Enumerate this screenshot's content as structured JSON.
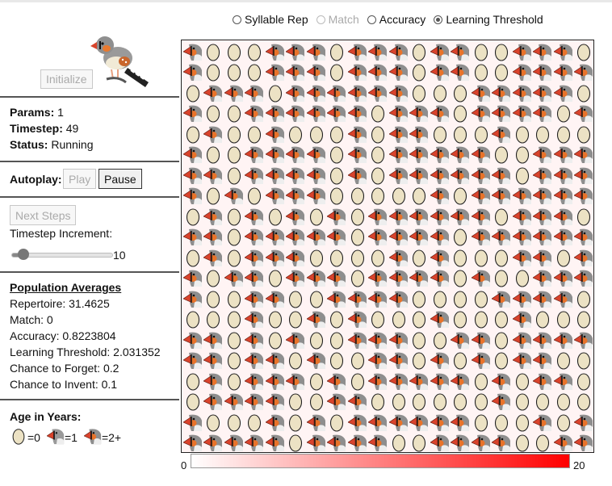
{
  "mode_options": [
    {
      "label": "Syllable Rep",
      "checked": false,
      "disabled": false
    },
    {
      "label": "Match",
      "checked": false,
      "disabled": true
    },
    {
      "label": "Accuracy",
      "checked": false,
      "disabled": false
    },
    {
      "label": "Learning Threshold",
      "checked": true,
      "disabled": false
    }
  ],
  "controls": {
    "initialize_label": "Initialize",
    "autoplay_label": "Autoplay:",
    "play_label": "Play",
    "pause_label": "Pause",
    "next_steps_label": "Next Steps",
    "timestep_increment_label": "Timestep Increment:",
    "timestep_increment_value": "10",
    "slider_fraction": 0.08
  },
  "status": {
    "params_label": "Params:",
    "params_value": "1",
    "timestep_label": "Timestep:",
    "timestep_value": "49",
    "status_label": "Status:",
    "status_value": "Running"
  },
  "averages": {
    "title": "Population Averages",
    "lines": [
      "Repertoire: 31.4625",
      "Match: 0",
      "Accuracy: 0.8223804",
      "Learning Threshold: 2.031352",
      "Chance to Forget: 0.2",
      "Chance to Invent: 0.1"
    ]
  },
  "legend": {
    "title": "Age in Years:",
    "egg_label": "=0",
    "juvenile_label": "=1",
    "adult_label": "=2+"
  },
  "color_scale": {
    "min": "0",
    "max": "20",
    "low_color": "#ffffff",
    "high_color": "#ff0000"
  },
  "grid": {
    "rows": [
      "AEEEAAAEAAAEAAEEAAAE",
      "AEEEAAAEAAAEAAEEAAAA",
      "EAAAEAAAAAAEEEAAAAAE",
      "AEEAAAAAAEAAAEAAAAEA",
      "EAEEAEEEAEAAEEEAEEEE",
      "AEEAAAAEAEAAAAAEEAAA",
      "AAEAAAAEAEAAAAAAEAAA",
      "AEAEAAAEEEEEAEAAAAAA",
      "EAEAEAEAEAAAAAAEAAAE",
      "AAEAAAAAEAAAAEAAAAAA",
      "EAEAAAEEEEAEAEEEAAEA",
      "AEAAEAAAEAAAAEAEEAAA",
      "AEEAAEEAAAAEEEEAAAAE",
      "EEEAEEAEAEEEAEEEAEEE",
      "AAEAEAEEAAAEEAAEAAAA",
      "AAEAAEAEEAAEAEAEAAEE",
      "EAEAAAEAEAAAAAEAEAAE",
      "EAAAAEEAAEEEEEEAEEEE",
      "AEEEAEAEAAAAAAEEEAEA",
      "AAAAAEAAAAEEAAAAEEAA"
    ]
  }
}
